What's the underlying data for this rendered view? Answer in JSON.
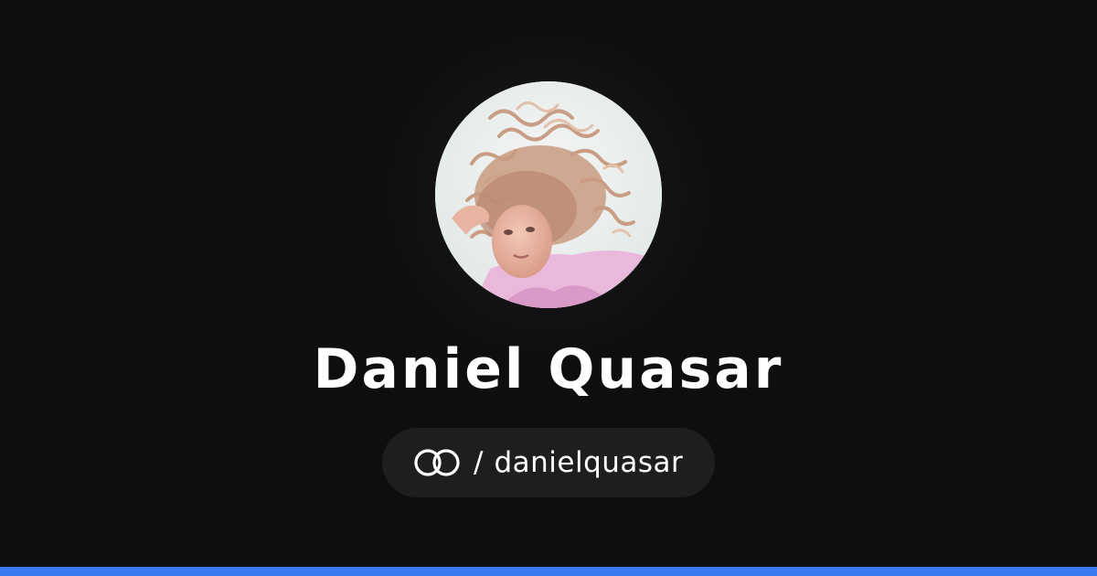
{
  "profile": {
    "name": "Daniel Quasar",
    "separator": "/",
    "handle": "danielquasar",
    "avatar_icon": "profile-photo"
  },
  "brand": {
    "logo_icon": "linked-rings-icon"
  },
  "colors": {
    "background": "#0e0e0f",
    "pill_background": "#1e1e20",
    "text": "#ffffff",
    "accent_bar": "#3a7af2"
  }
}
